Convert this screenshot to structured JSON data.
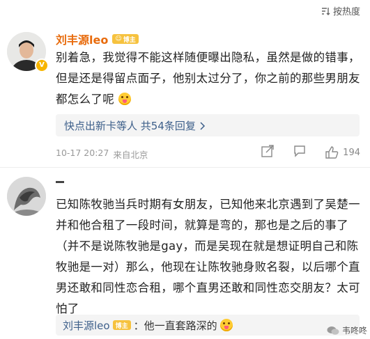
{
  "sort": {
    "label": "按热度"
  },
  "comment1": {
    "username": "刘丰源leo",
    "badge": "博主",
    "text": "别着急，我觉得不能这样随便曝出隐私，虽然是做的错事，但是还是得留点面子，他别太过分了，你之前的那些男朋友都怎么了呢",
    "replies_label": "快点出新卡等人 共54条回复",
    "time": "10-17 20:27",
    "location": "来自北京",
    "like_count": "194"
  },
  "comment2": {
    "username": "",
    "text": "已知陈牧驰当兵时期有女朋友，已知他来北京遇到了吴楚一并和他合租了一段时间，就算是弯的，那也是之后的事了（并不是说陈牧驰是gay，而是吴现在就是想证明自己和陈牧驰是一对）那么，他现在让陈牧驰身败名裂，以后哪个直男还敢和同性恋合租，哪个直男还敢和同性恋交朋友？太可怕了",
    "sub_reply": {
      "username": "刘丰源leo",
      "badge": "博主",
      "text": "：他一直套路深的"
    }
  },
  "watermark": {
    "text": "韦咚咚"
  },
  "colors": {
    "username": "#e86b0c",
    "link": "#3d5f8a",
    "meta": "#999999",
    "badge": "#f6c23e"
  }
}
